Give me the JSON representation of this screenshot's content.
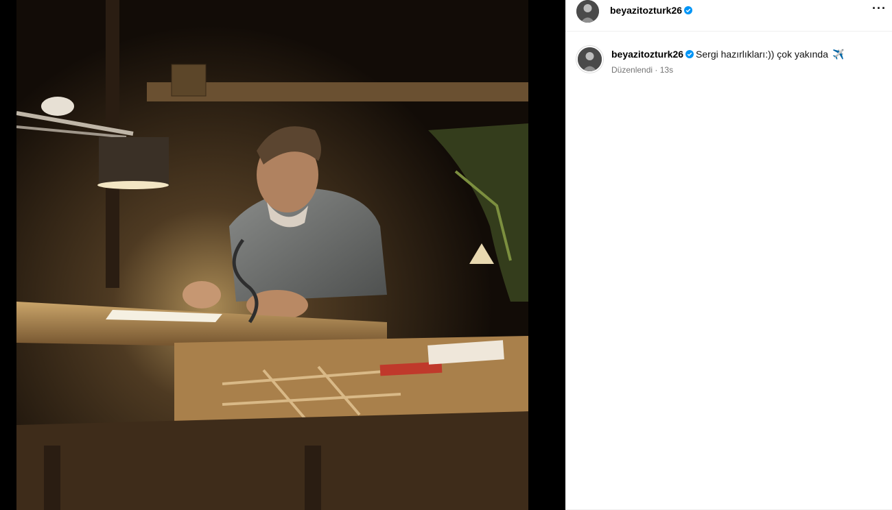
{
  "post": {
    "username": "beyazitozturk26",
    "verified": true,
    "more_icon": "more-horizontal-icon",
    "caption_text": "Sergi hazırlıkları:)) çok yakında",
    "caption_emoji": "✈️",
    "edited_label": "Düzenlendi",
    "separator": "·",
    "time_ago": "13s"
  },
  "colors": {
    "verified_badge": "#0095f6",
    "muted_text": "#737373",
    "background": "#ffffff"
  }
}
